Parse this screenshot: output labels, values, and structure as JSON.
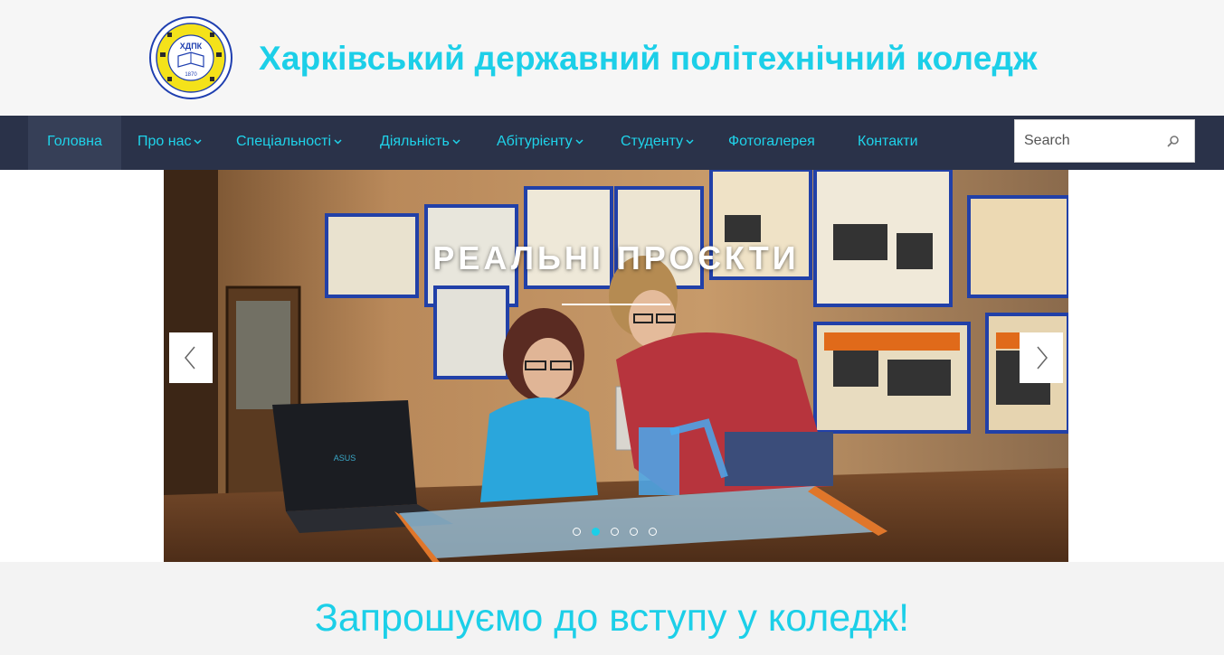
{
  "header": {
    "title": "Харківський державний політехнічний коледж",
    "logo": {
      "abbr": "ХДПК",
      "year": "1870",
      "ring_text": "ХАРКІВСЬКИЙ ДЕРЖАВНИЙ ПОЛІТЕХНІЧНИЙ КОЛЕДЖ"
    }
  },
  "nav": {
    "items": [
      {
        "label": "Головна",
        "active": true,
        "has_submenu": false
      },
      {
        "label": "Про нас",
        "active": false,
        "has_submenu": true
      },
      {
        "label": "Спеціальності",
        "active": false,
        "has_submenu": true
      },
      {
        "label": "Діяльність",
        "active": false,
        "has_submenu": true
      },
      {
        "label": "Абітурієнту",
        "active": false,
        "has_submenu": true
      },
      {
        "label": "Студенту",
        "active": false,
        "has_submenu": true
      },
      {
        "label": "Фотогалерея",
        "active": false,
        "has_submenu": false
      },
      {
        "label": "Контакти",
        "active": false,
        "has_submenu": false
      }
    ],
    "search": {
      "placeholder": "Search",
      "value": "",
      "icon": "search-icon"
    }
  },
  "slider": {
    "title": "РЕАЛЬНІ ПРОЄКТИ",
    "prev_icon": "chevron-left-icon",
    "next_icon": "chevron-right-icon",
    "slide_count": 5,
    "active_index": 1,
    "laptop_brand": "ASUS"
  },
  "promo": {
    "heading": "Запрошуємо до вступу у коледж!"
  },
  "colors": {
    "accent": "#1ccfe8",
    "nav_bg": "#2a3249",
    "nav_active_bg": "#363f57",
    "header_bg": "#f6f6f6"
  }
}
